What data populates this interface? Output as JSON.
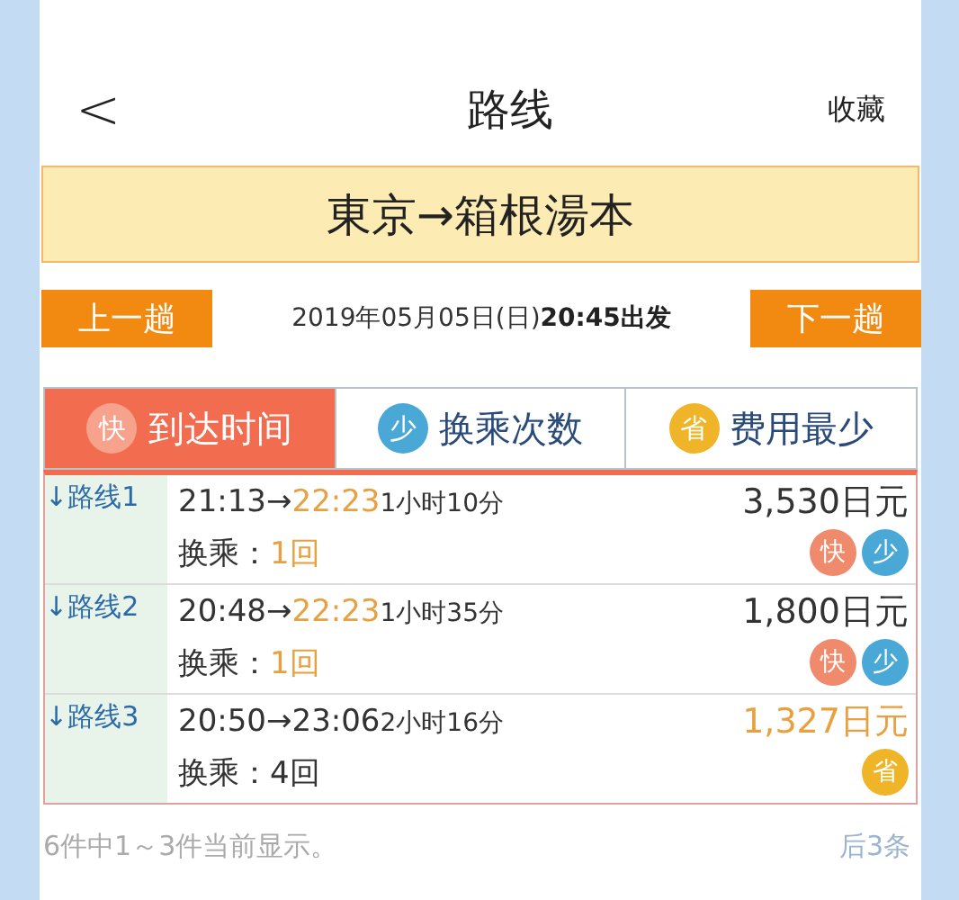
{
  "header": {
    "back": "<",
    "title": "路线",
    "action": "收藏"
  },
  "route_banner": "東京→箱根湯本",
  "nav": {
    "prev": "上一趟",
    "date": "2019年05月05日(日)",
    "time": "20:45出发",
    "next": "下一趟"
  },
  "tabs": [
    {
      "icon": "快",
      "label": "到达时间",
      "color": "#f6a28c",
      "selected": true
    },
    {
      "icon": "少",
      "label": "换乘次数",
      "color": "#4aa8d6",
      "selected": false
    },
    {
      "icon": "省",
      "label": "费用最少",
      "color": "#f0b429",
      "selected": false
    }
  ],
  "routes": [
    {
      "name": "↓路线1",
      "depart": "21:13→",
      "arrive": "22:23",
      "arrive_highlight": true,
      "duration": "1小时10分",
      "price": "3,530日元",
      "price_highlight": false,
      "transfer_label": "换乘：",
      "transfers": "1回",
      "transfers_highlight": true,
      "badges": [
        {
          "text": "快",
          "color": "#ef8a6c"
        },
        {
          "text": "少",
          "color": "#4aa8d6"
        }
      ]
    },
    {
      "name": "↓路线2",
      "depart": "20:48→",
      "arrive": "22:23",
      "arrive_highlight": true,
      "duration": "1小时35分",
      "price": "1,800日元",
      "price_highlight": false,
      "transfer_label": "换乘：",
      "transfers": "1回",
      "transfers_highlight": true,
      "badges": [
        {
          "text": "快",
          "color": "#ef8a6c"
        },
        {
          "text": "少",
          "color": "#4aa8d6"
        }
      ]
    },
    {
      "name": "↓路线3",
      "depart": "20:50→",
      "arrive": "23:06",
      "arrive_highlight": false,
      "duration": "2小时16分",
      "price": "1,327日元",
      "price_highlight": true,
      "transfer_label": "换乘：",
      "transfers": "4回",
      "transfers_highlight": false,
      "badges": [
        {
          "text": "省",
          "color": "#f0b429"
        }
      ]
    }
  ],
  "footer": {
    "summary": "6件中1～3件当前显示。",
    "more": "后3条"
  }
}
